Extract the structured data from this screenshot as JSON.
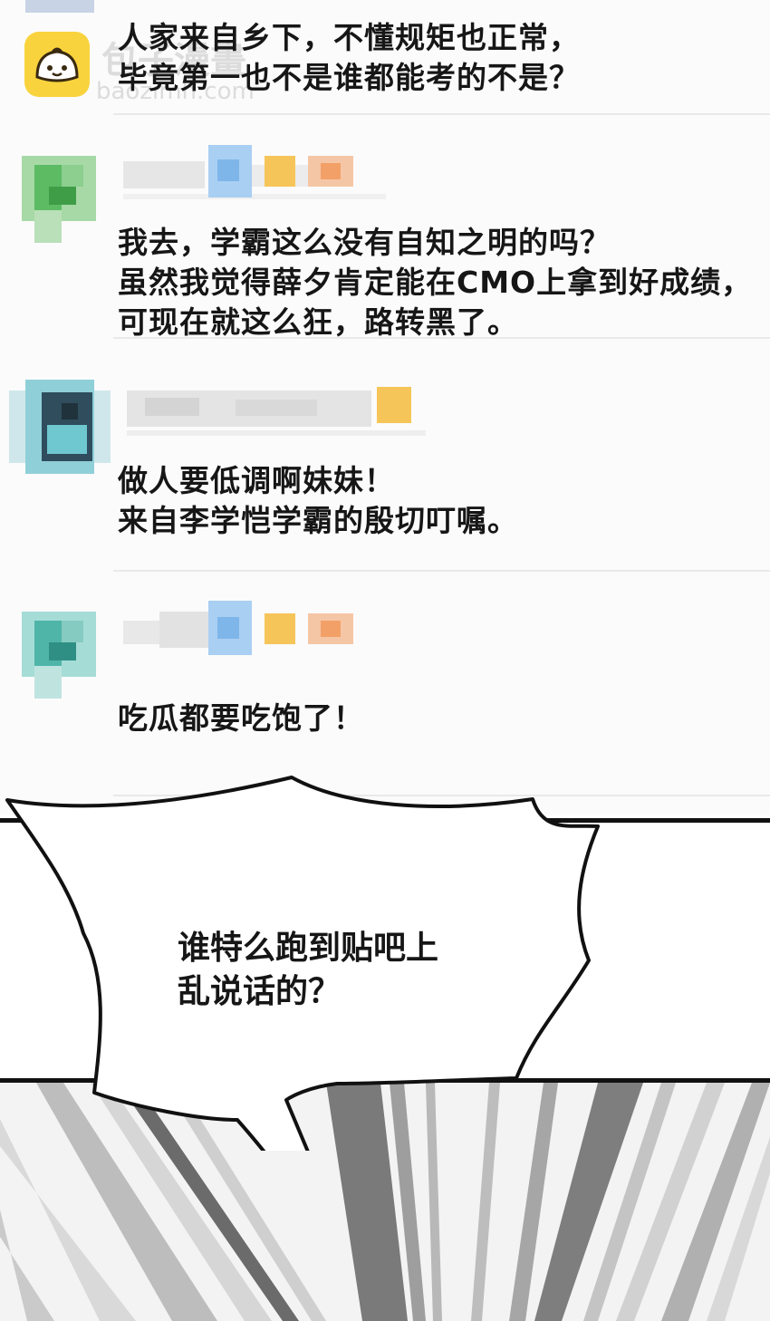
{
  "watermark": {
    "cn": "包子漫畫",
    "url": "baozimh.com"
  },
  "comments": [
    {
      "lines": [
        "人家来自乡下，不懂规矩也正常，",
        "毕竟第一也不是谁都能考的不是？"
      ]
    },
    {
      "lines": [
        "我去，学霸这么没有自知之明的吗？",
        "虽然我觉得薛夕肯定能在CMO上拿到好成绩，",
        "可现在就这么狂，路转黑了。"
      ]
    },
    {
      "lines": [
        "做人要低调啊妹妹！",
        "来自李学恺学霸的殷切叮嘱。"
      ]
    },
    {
      "lines": [
        "吃瓜都要吃饱了！"
      ]
    }
  ],
  "speech_bubble": {
    "lines": [
      "谁特么跑到贴吧上",
      "乱说话的？"
    ]
  },
  "colors": {
    "logo": "#f9d33d",
    "avatar_green": "#5dbb63",
    "avatar_teal": "#4fb5a9",
    "avatar_dark": "#2f4d5c",
    "badge_yellow": "#f6c55a",
    "badge_orange": "#f2a068",
    "badge_blue": "#7fb6ea"
  }
}
